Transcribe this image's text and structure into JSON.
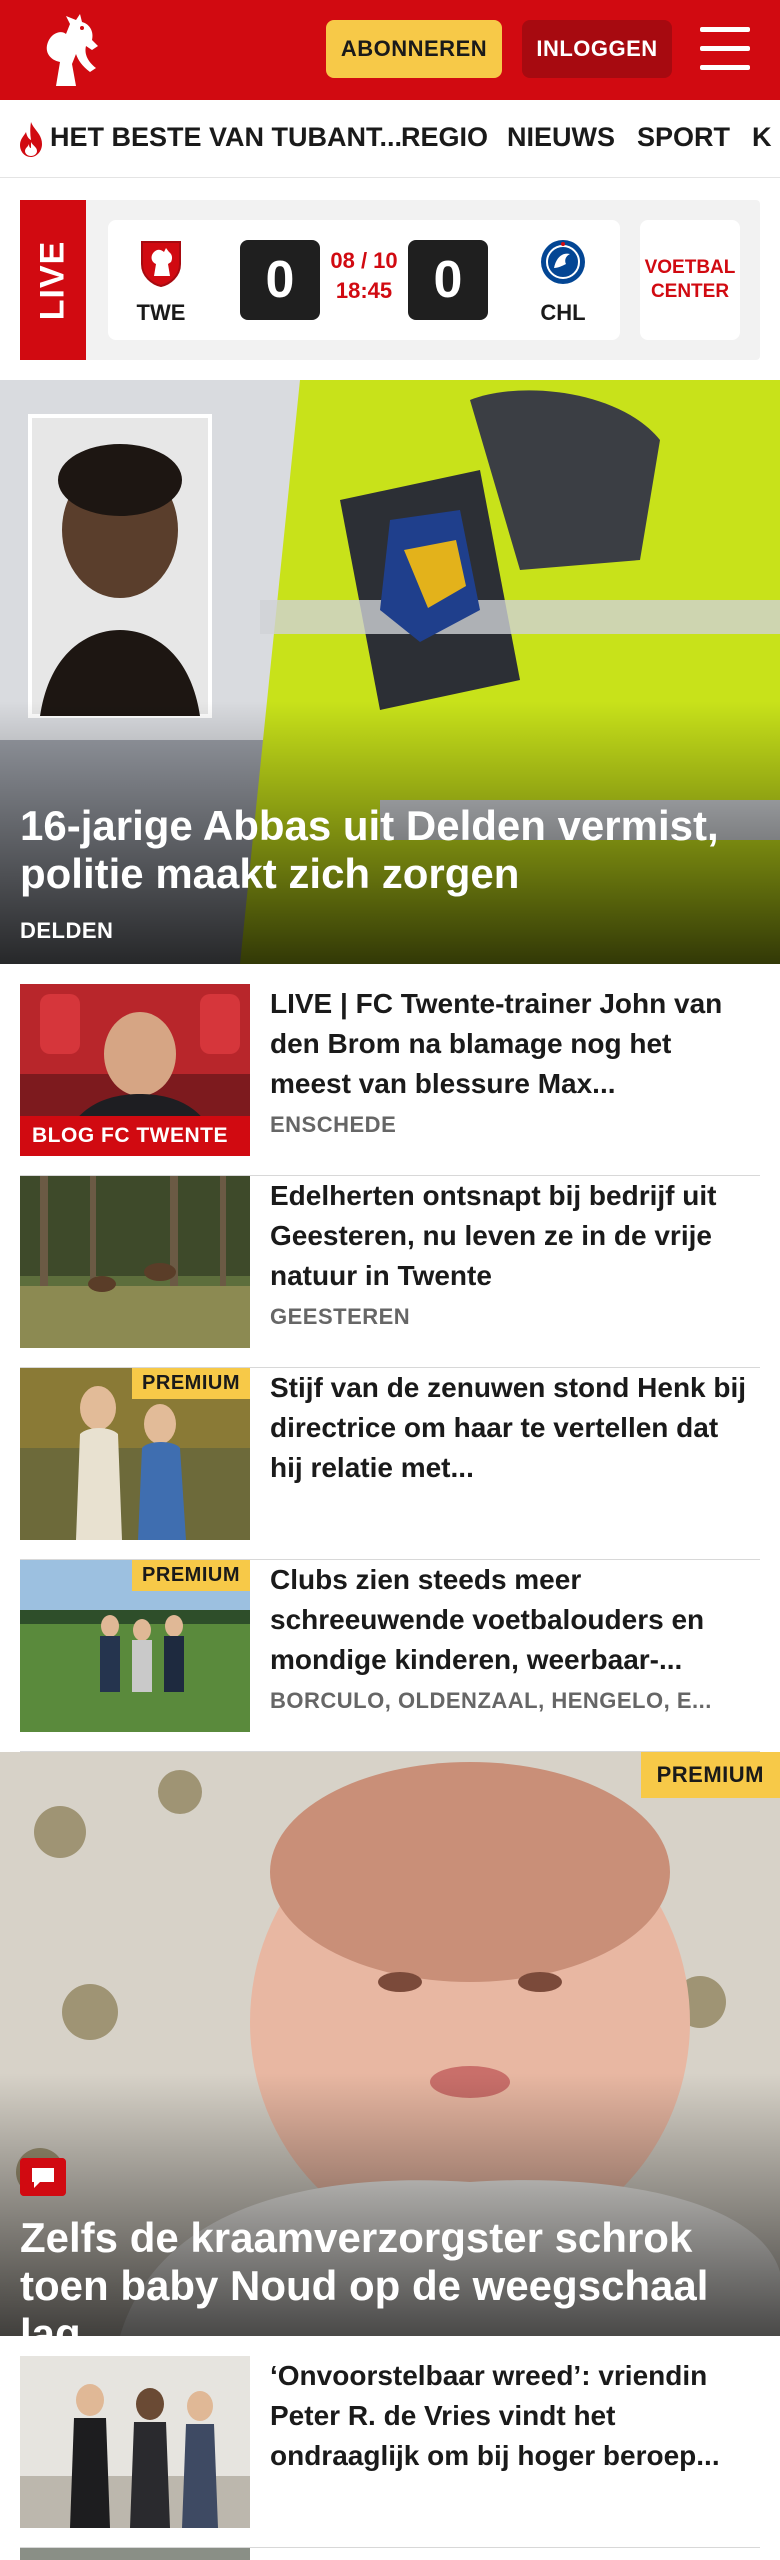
{
  "header": {
    "subscribe_label": "ABONNEREN",
    "login_label": "INLOGGEN",
    "brand_color": "#d10a11",
    "accent_color": "#f7c948"
  },
  "nav": {
    "items": [
      {
        "label": "HET BESTE VAN TUBANT...",
        "icon": "flame-icon"
      },
      {
        "label": "REGIO"
      },
      {
        "label": "NIEUWS"
      },
      {
        "label": "SPORT"
      },
      {
        "label": "K"
      }
    ]
  },
  "live": {
    "label": "LIVE",
    "home_team": "TWE",
    "away_team": "CHL",
    "home_score": "0",
    "away_score": "0",
    "date": "08 / 10",
    "time": "18:45",
    "center_label": "VOETBAL CENTER"
  },
  "hero": {
    "title": "16-jarige Abbas uit Delden vermist, politie maakt zich zorgen",
    "location": "DELDEN"
  },
  "articles": [
    {
      "title": "LIVE | FC Twente-trainer John van den Brom na blamage nog het meest van blessure Max...",
      "location": "ENSCHEDE",
      "badge": "BLOG FC TWENTE"
    },
    {
      "title": "Edelherten ontsnapt bij bedrijf uit Geesteren, nu leven ze in de vrije natuur in Twente",
      "location": "GEESTEREN"
    },
    {
      "title": "Stijf van de zenuwen stond Henk bij directrice om haar te vertellen dat hij relatie met...",
      "location": "",
      "badge": "PREMIUM"
    },
    {
      "title": "Clubs zien steeds meer schreeuwende voetbalouders en mondige kinderen, weerbaar-...",
      "location": "BORCULO, OLDENZAAL, HENGELO, E...",
      "badge": "PREMIUM"
    }
  ],
  "big_article": {
    "title": "Zelfs de kraamverzorgster schrok toen baby Noud op de weegschaal lag",
    "badge": "PREMIUM"
  },
  "articles2": [
    {
      "title": "‘Onvoorstelbaar wreed’: vriendin Peter R. de Vries vindt het ondraaglijk om bij hoger beroep...",
      "location": ""
    }
  ]
}
